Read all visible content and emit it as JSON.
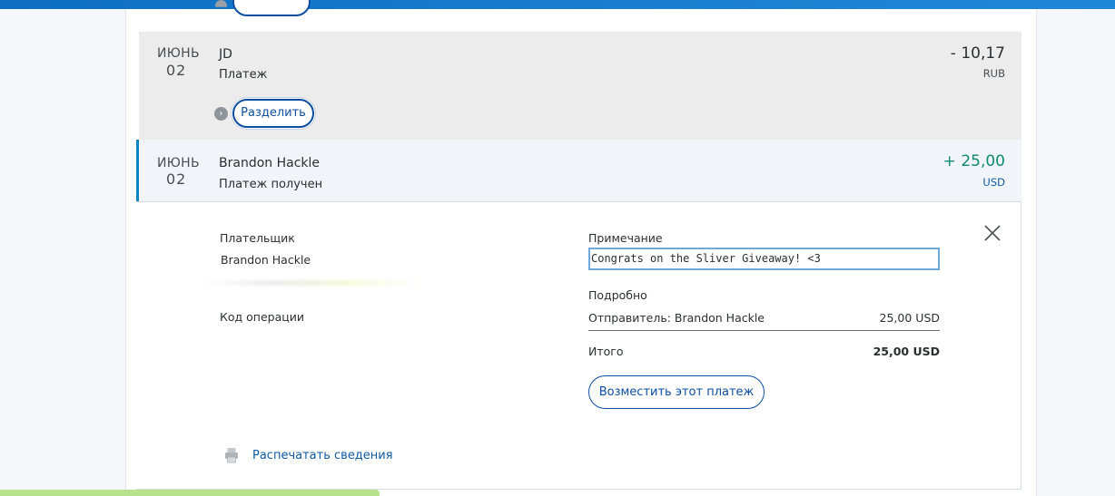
{
  "transactions": [
    {
      "month": "ИЮНЬ",
      "day": "02",
      "name": "JD",
      "type": "Платеж",
      "amount": "- 10,17",
      "currency": "RUB",
      "split_label": "Разделить"
    },
    {
      "month": "ИЮНЬ",
      "day": "02",
      "name": "Brandon Hackle",
      "type": "Платеж получен",
      "amount": "+ 25,00",
      "currency": "USD"
    }
  ],
  "details": {
    "payer_label": "Плательщик",
    "payer_name": "Brandon Hackle",
    "transaction_id_label": "Код операции",
    "note_label": "Примечание",
    "note_value": "Congrats on the Sliver Giveaway! <3",
    "breakdown_label": "Подробно",
    "sender_line": "Отправитель: Brandon Hackle",
    "sender_amount": "25,00 USD",
    "total_label": "Итого",
    "total_amount": "25,00 USD",
    "refund_button": "Возместить этот платеж",
    "print_link": "Распечатать сведения"
  },
  "colors": {
    "accent_blue": "#0e4ea1",
    "positive_green": "#0c8a72",
    "selected_bar": "#0b84c8",
    "detail_bar": "#4fc0ec"
  },
  "icons": [
    "chevron-right-icon",
    "close-icon",
    "printer-icon"
  ]
}
